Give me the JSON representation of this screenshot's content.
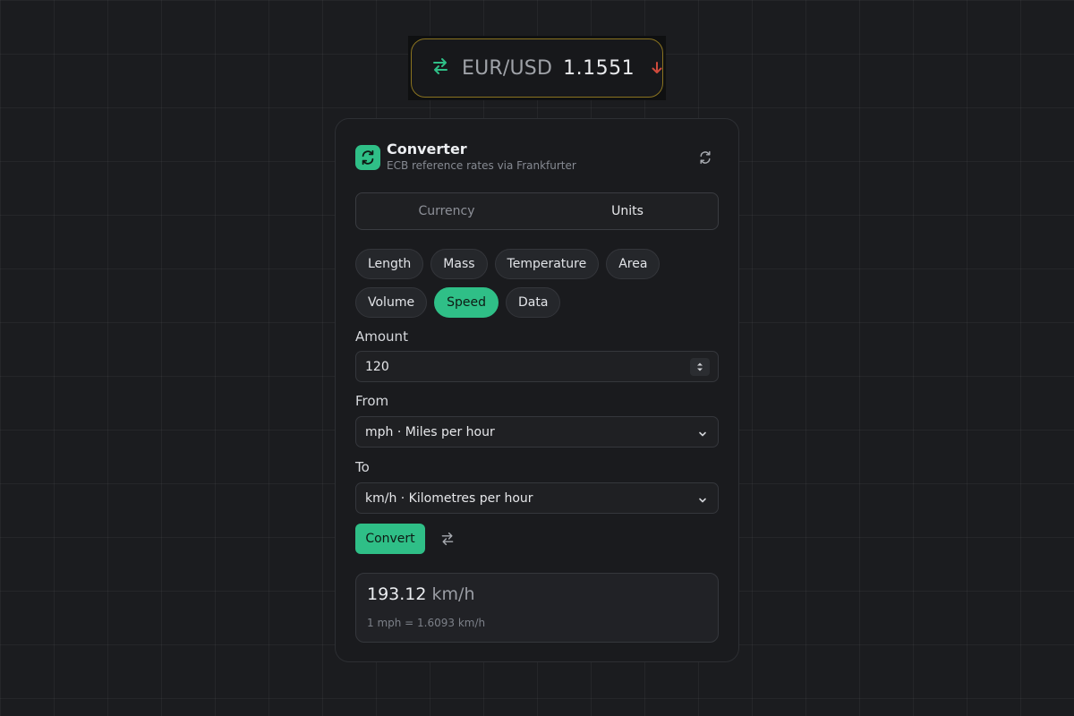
{
  "ticker": {
    "pair": "EUR/USD",
    "rate": "1.1551",
    "direction": "down",
    "accent_color": "#2fbf87",
    "down_color": "#d04a3c",
    "border_color": "#8a7320",
    "icons": [
      "swap-arrows-icon",
      "arrow-down-icon"
    ]
  },
  "header": {
    "title": "Converter",
    "subtitle": "ECB reference rates via Frankfurter",
    "icons": [
      "swap-arrows-icon",
      "refresh-icon"
    ]
  },
  "mode_tabs": [
    {
      "label": "Currency",
      "active": false
    },
    {
      "label": "Units",
      "active": true
    }
  ],
  "categories": {
    "row1": [
      {
        "label": "Length",
        "active": false
      },
      {
        "label": "Mass",
        "active": false
      },
      {
        "label": "Temperature",
        "active": false
      },
      {
        "label": "Area",
        "active": false
      }
    ],
    "row2": [
      {
        "label": "Volume",
        "active": false
      },
      {
        "label": "Speed",
        "active": true
      },
      {
        "label": "Data",
        "active": false
      }
    ]
  },
  "form": {
    "amount_label": "Amount",
    "amount_value": "120",
    "from_label": "From",
    "from_value": "mph · Miles per hour",
    "to_label": "To",
    "to_value": "km/h · Kilometres per hour",
    "convert_label": "Convert"
  },
  "result": {
    "value": "193.12",
    "unit": "km/h",
    "rate_note": "1 mph = 1.6093 km/h"
  },
  "colors": {
    "accent": "#2fbf87",
    "background": "#1b1c1f",
    "card": "#1a1b1e"
  }
}
